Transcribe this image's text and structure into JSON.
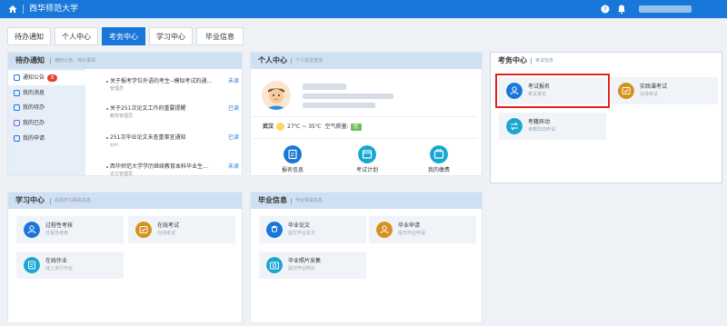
{
  "app": {
    "title": "西华师范大学"
  },
  "topbar": {
    "home_icon": "home-icon",
    "help_icon": "help-icon",
    "notify_icon": "bell-icon"
  },
  "tabs": [
    {
      "label": "待办通知",
      "active": false
    },
    {
      "label": "个人中心",
      "active": false
    },
    {
      "label": "考务中心",
      "active": true
    },
    {
      "label": "学习中心",
      "active": false
    },
    {
      "label": "毕业信息",
      "active": false
    }
  ],
  "todo": {
    "title": "待办通知",
    "subtitle": "通知公告，待办事项",
    "nav": [
      {
        "label": "通知公告",
        "badge": "8",
        "active": true
      },
      {
        "label": "我的消息",
        "active": false
      },
      {
        "label": "我的待办",
        "active": false
      },
      {
        "label": "我的已办",
        "active": false
      },
      {
        "label": "我的申请",
        "active": false
      }
    ],
    "notices": [
      {
        "title": "关于报考学位外语的考生--模拟考试的通...",
        "sub": "管理员",
        "status": "未读"
      },
      {
        "title": "关于251次论文工作的重要提醒",
        "sub": "教务管理员",
        "status": "已读"
      },
      {
        "title": "251次毕业论文未查重事宜通知",
        "sub": "zyh",
        "status": "已读"
      },
      {
        "title": "西华师范大学学历继续教育本科毕业生...",
        "sub": "论文管理员",
        "status": "未读"
      }
    ]
  },
  "personal": {
    "title": "个人中心",
    "subtitle": "个人信息查询",
    "weather": {
      "city": "武汉",
      "temp": "27℃ ~ 35℃",
      "aq_label": "空气质量:",
      "aq_value": "优"
    },
    "quick": [
      {
        "label": "报名信息",
        "icon": "register-icon"
      },
      {
        "label": "考试计划",
        "icon": "plan-icon"
      },
      {
        "label": "我的缴费",
        "icon": "payment-icon"
      }
    ]
  },
  "exam": {
    "title": "考务中心",
    "subtitle": "考试信息",
    "cards": [
      {
        "title": "考试报名",
        "sub": "考试报名",
        "icon": "exam-register-icon",
        "color": "#1877d8",
        "highlight": true
      },
      {
        "title": "实践课考试",
        "sub": "在线考试",
        "icon": "practice-exam-icon",
        "color": "#d6901c",
        "highlight": false
      },
      {
        "title": "考籍异动",
        "sub": "考籍异动申请",
        "icon": "status-change-icon",
        "color": "#1aa7cf",
        "highlight": false
      }
    ]
  },
  "study": {
    "title": "学习中心",
    "subtitle": "在线学习相关信息",
    "cards": [
      {
        "title": "过程性考核",
        "sub": "过程性考核",
        "icon": "assessment-icon",
        "color": "#1877d8"
      },
      {
        "title": "在线考试",
        "sub": "在线考试",
        "icon": "online-exam-icon",
        "color": "#d6901c"
      },
      {
        "title": "在线作业",
        "sub": "线上进行作业",
        "icon": "homework-icon",
        "color": "#1aa7cf"
      }
    ]
  },
  "graduate": {
    "title": "毕业信息",
    "subtitle": "毕业相关信息",
    "cards": [
      {
        "title": "毕业论文",
        "sub": "提交毕业论文",
        "icon": "thesis-icon",
        "color": "#1877d8"
      },
      {
        "title": "毕业申请",
        "sub": "提交毕业申请",
        "icon": "graduate-apply-icon",
        "color": "#d6901c"
      },
      {
        "title": "毕业照片采集",
        "sub": "提交毕业照片",
        "icon": "photo-icon",
        "color": "#1aa7cf"
      }
    ]
  }
}
